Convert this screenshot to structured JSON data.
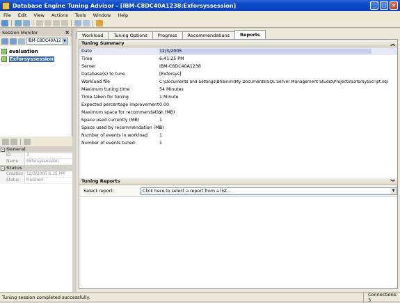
{
  "window": {
    "title": "Database Engine Tuning Advisor - [IBM-C8DC40A1238:Exforsyssession]"
  },
  "menu": [
    "File",
    "Edit",
    "View",
    "Actions",
    "Tools",
    "Window",
    "Help"
  ],
  "session_monitor": {
    "title": "Session Monitor",
    "server": "IBM-C8DC40A12",
    "sessions": [
      "evaluation",
      "Exforsyssession"
    ]
  },
  "properties": {
    "categories": [
      {
        "name": "General",
        "rows": [
          {
            "name": "ID",
            "value": "3"
          },
          {
            "name": "Name",
            "value": "Exforsyssession"
          }
        ]
      },
      {
        "name": "Status",
        "rows": [
          {
            "name": "Creation time",
            "value": "12/3/2005 6:35 PM"
          },
          {
            "name": "Status",
            "value": "Finished"
          }
        ]
      }
    ]
  },
  "tabs": [
    "Workload",
    "Tuning Options",
    "Progress",
    "Recommendations",
    "Reports"
  ],
  "summary": {
    "title": "Tuning Summary",
    "rows": [
      {
        "label": "Date",
        "value": "12/3/2005"
      },
      {
        "label": "Time",
        "value": "6:41:25 PM"
      },
      {
        "label": "Server",
        "value": "IBM-C8DC40A1238"
      },
      {
        "label": "Database(s) to tune",
        "value": "[Exforsys]"
      },
      {
        "label": "Workload file",
        "value": "C:\\Documents and Settings\\Bhamini\\My Documents\\SQL Server Management Studio\\Projects\\ExforsysScript.sql"
      },
      {
        "label": "Maximum tuning time",
        "value": "54 Minutes"
      },
      {
        "label": "Time taken for tuning",
        "value": "1 Minute"
      },
      {
        "label": "Expected percentage improvement",
        "value": "0.00"
      },
      {
        "label": "Maximum space for recommendation (MB)",
        "value": "2"
      },
      {
        "label": "Space used currently (MB)",
        "value": "1"
      },
      {
        "label": "Space used by recommendation (MB)",
        "value": "1"
      },
      {
        "label": "Number of events in workload",
        "value": "1"
      },
      {
        "label": "Number of events tuned",
        "value": "1"
      }
    ]
  },
  "reports": {
    "title": "Tuning Reports",
    "select_label": "Select report:",
    "select_value": "Click here to select a report from a list..."
  },
  "status": {
    "message": "Tuning session completed successfully.",
    "connections": "Connections: 3"
  }
}
